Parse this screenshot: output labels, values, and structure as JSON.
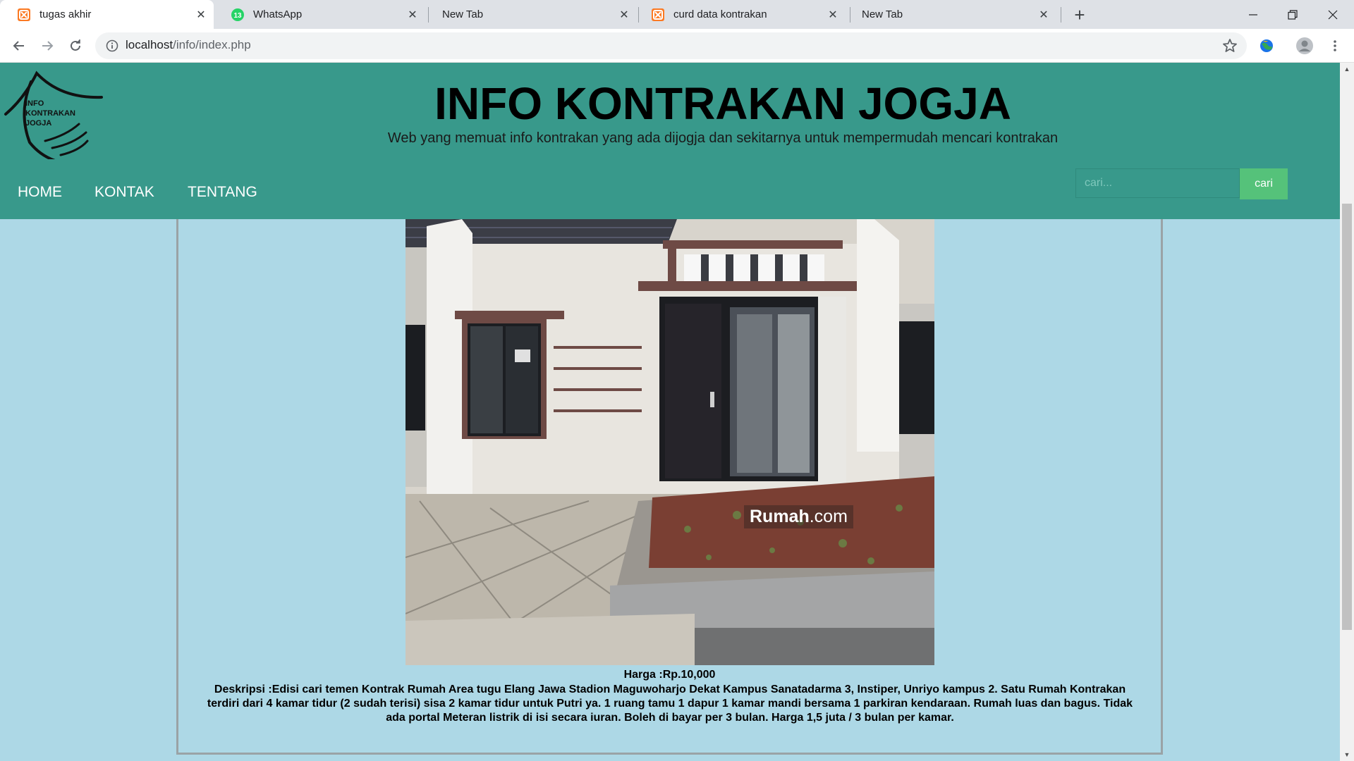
{
  "browser": {
    "tabs": [
      {
        "title": "tugas akhir",
        "icon": "xampp-icon",
        "active": true
      },
      {
        "title": "WhatsApp",
        "icon": "whatsapp-icon",
        "badge": "13",
        "active": false
      },
      {
        "title": "New Tab",
        "icon": "",
        "active": false
      },
      {
        "title": "curd data kontrakan",
        "icon": "xampp-icon",
        "active": false
      },
      {
        "title": "New Tab",
        "icon": "",
        "active": false
      }
    ],
    "url_host": "localhost",
    "url_path": "/info/index.php",
    "accent": "#38998b"
  },
  "site": {
    "title": "INFO KONTRAKAN JOGJA",
    "subtitle": "Web yang memuat info kontrakan yang ada dijogja dan sekitarnya untuk mempermudah mencari kontrakan",
    "logo_text": [
      "INFO",
      "KONTRAKAN",
      "JOGJA"
    ],
    "nav": [
      "HOME",
      "KONTAK",
      "TENTANG"
    ],
    "search_placeholder": "cari...",
    "search_button": "cari"
  },
  "listing": {
    "image_watermark_brand": "Rumah",
    "image_watermark_suffix": ".com",
    "price": "Harga :Rp.10,000",
    "description": "Deskripsi :Edisi cari temen Kontrak Rumah Area tugu Elang Jawa Stadion Maguwoharjo Dekat Kampus Sanatadarma 3, Instiper, Unriyo kampus 2. Satu Rumah Kontrakan terdiri dari 4 kamar tidur (2 sudah terisi) sisa 2 kamar tidur untuk Putri ya. 1 ruang tamu 1 dapur 1 kamar mandi bersama 1 parkiran kendaraan. Rumah luas dan bagus. Tidak ada portal Meteran listrik di isi secara iuran. Boleh di bayar per 3 bulan. Harga 1,5 juta / 3 bulan per kamar."
  }
}
